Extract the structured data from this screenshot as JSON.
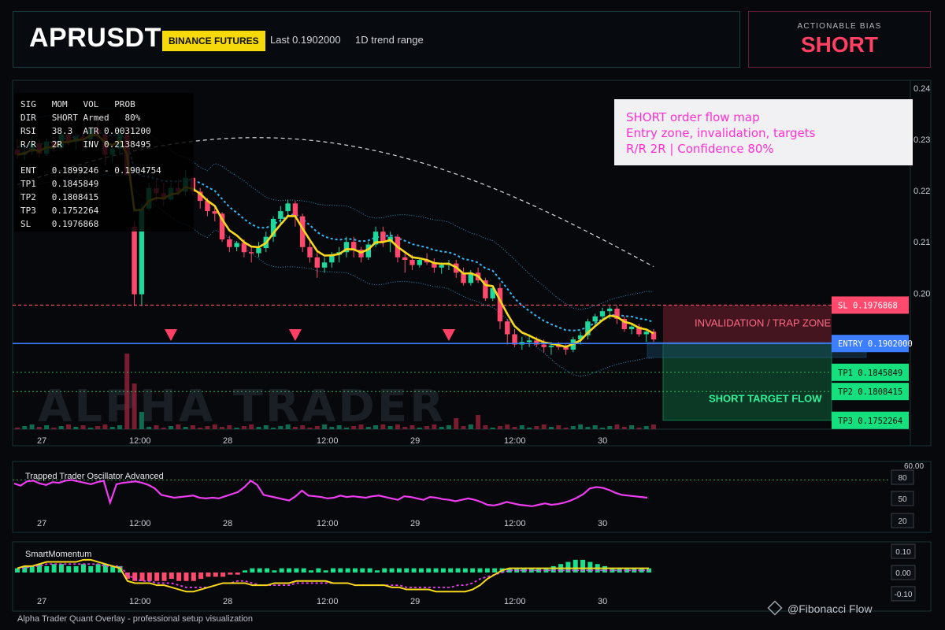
{
  "header": {
    "symbol": "APRUSDT",
    "exchange": "BINANCE FUTURES",
    "last": "Last 0.1902000",
    "range": "1D trend range",
    "bias_label": "ACTIONABLE BIAS",
    "bias_value": "SHORT"
  },
  "signal_box": {
    "rows": [
      "SIG   MOM   VOL   PROB",
      "DIR   SHORT Armed   80%",
      "RSI   38.3  ATR 0.0031200",
      "R/R   2R    INV 0.2138495",
      "",
      "ENT   0.1899246 - 0.1904754",
      "TP1   0.1845849",
      "TP2   0.1808415",
      "TP3   0.1752264",
      "SL    0.1976868"
    ]
  },
  "info_box": {
    "line1": "SHORT order flow map",
    "line2": "Entry zone, invalidation, targets",
    "line3": "R/R 2R | Confidence 80%"
  },
  "watermark": "ALPHA TRADER",
  "footer": "Alpha Trader Quant Overlay - professional setup visualization",
  "credit": "@Fibonacci Flow",
  "colors": {
    "up": "#1fd89c",
    "down": "#ff4a6e",
    "ema": "#f8d81c",
    "ema_slow": "#33b6f3",
    "entry": "#3d7dff",
    "sl": "#ff4a6e",
    "tp": "#16e07d",
    "oscillator": "#ee3cf0"
  },
  "chart_data": [
    {
      "type": "candlestick",
      "name": "APRUSDT price",
      "x_ticks": [
        "27",
        "12:00",
        "28",
        "12:00",
        "29",
        "12:00",
        "30"
      ],
      "y_ticks": [
        "0.24",
        "0.23",
        "0.22",
        "0.21",
        "0.20"
      ],
      "ylim": [
        0.1735,
        0.2415
      ],
      "ohlc": [
        [
          0.228,
          0.23,
          0.2262,
          0.227
        ],
        [
          0.227,
          0.229,
          0.226,
          0.2276
        ],
        [
          0.2276,
          0.2305,
          0.227,
          0.2292
        ],
        [
          0.2292,
          0.23,
          0.2265,
          0.2272
        ],
        [
          0.2272,
          0.2302,
          0.2268,
          0.2296
        ],
        [
          0.2296,
          0.2305,
          0.2275,
          0.2283
        ],
        [
          0.2283,
          0.232,
          0.228,
          0.231
        ],
        [
          0.231,
          0.2325,
          0.2288,
          0.2295
        ],
        [
          0.2295,
          0.2312,
          0.228,
          0.2305
        ],
        [
          0.2305,
          0.2318,
          0.2285,
          0.23
        ],
        [
          0.23,
          0.2325,
          0.229,
          0.232
        ],
        [
          0.232,
          0.2335,
          0.23,
          0.231
        ],
        [
          0.231,
          0.232,
          0.225,
          0.227
        ],
        [
          0.227,
          0.229,
          0.2255,
          0.2282
        ],
        [
          0.2282,
          0.232,
          0.227,
          0.231
        ],
        [
          0.231,
          0.232,
          0.224,
          0.223
        ],
        [
          0.213,
          0.214,
          0.1975,
          0.1998
        ],
        [
          0.1998,
          0.2175,
          0.1975,
          0.2165
        ],
        [
          0.2165,
          0.2215,
          0.216,
          0.2205
        ],
        [
          0.2205,
          0.2225,
          0.218,
          0.2195
        ],
        [
          0.2195,
          0.2215,
          0.217,
          0.2183
        ],
        [
          0.2183,
          0.2215,
          0.218,
          0.2205
        ],
        [
          0.2205,
          0.222,
          0.219,
          0.2198
        ],
        [
          0.2198,
          0.224,
          0.219,
          0.2225
        ],
        [
          0.2225,
          0.2228,
          0.219,
          0.2198
        ],
        [
          0.2198,
          0.2205,
          0.2165,
          0.218
        ],
        [
          0.218,
          0.2185,
          0.215,
          0.216
        ],
        [
          0.216,
          0.217,
          0.214,
          0.2155
        ],
        [
          0.2155,
          0.2158,
          0.21,
          0.2105
        ],
        [
          0.2105,
          0.2112,
          0.208,
          0.209
        ],
        [
          0.209,
          0.2102,
          0.2082,
          0.2098
        ],
        [
          0.2098,
          0.2105,
          0.207,
          0.208
        ],
        [
          0.208,
          0.209,
          0.206,
          0.2078
        ],
        [
          0.2078,
          0.21,
          0.207,
          0.2088
        ],
        [
          0.2088,
          0.212,
          0.208,
          0.211
        ],
        [
          0.211,
          0.215,
          0.21,
          0.2145
        ],
        [
          0.2145,
          0.217,
          0.2135,
          0.216
        ],
        [
          0.216,
          0.2182,
          0.215,
          0.2175
        ],
        [
          0.2175,
          0.218,
          0.213,
          0.215
        ],
        [
          0.215,
          0.2155,
          0.208,
          0.209
        ],
        [
          0.209,
          0.21,
          0.206,
          0.207
        ],
        [
          0.207,
          0.208,
          0.203,
          0.205
        ],
        [
          0.205,
          0.207,
          0.204,
          0.206
        ],
        [
          0.206,
          0.208,
          0.205,
          0.2075
        ],
        [
          0.2075,
          0.209,
          0.206,
          0.208
        ],
        [
          0.208,
          0.211,
          0.207,
          0.21
        ],
        [
          0.21,
          0.211,
          0.207,
          0.2085
        ],
        [
          0.2085,
          0.209,
          0.206,
          0.207
        ],
        [
          0.207,
          0.21,
          0.2065,
          0.2095
        ],
        [
          0.2095,
          0.213,
          0.209,
          0.212
        ],
        [
          0.212,
          0.213,
          0.209,
          0.21
        ],
        [
          0.21,
          0.212,
          0.208,
          0.211
        ],
        [
          0.211,
          0.2115,
          0.206,
          0.207
        ],
        [
          0.207,
          0.208,
          0.204,
          0.2065
        ],
        [
          0.2065,
          0.2075,
          0.2045,
          0.2055
        ],
        [
          0.2055,
          0.207,
          0.205,
          0.2065
        ],
        [
          0.2065,
          0.2078,
          0.2055,
          0.206
        ],
        [
          0.206,
          0.2068,
          0.204,
          0.205
        ],
        [
          0.205,
          0.206,
          0.2038,
          0.2055
        ],
        [
          0.2055,
          0.2065,
          0.2045,
          0.2058
        ],
        [
          0.2058,
          0.2065,
          0.203,
          0.204
        ],
        [
          0.204,
          0.205,
          0.2015,
          0.202
        ],
        [
          0.202,
          0.2045,
          0.2015,
          0.204
        ],
        [
          0.204,
          0.205,
          0.202,
          0.2025
        ],
        [
          0.2025,
          0.203,
          0.1985,
          0.199
        ],
        [
          0.199,
          0.2015,
          0.1985,
          0.201
        ],
        [
          0.201,
          0.202,
          0.193,
          0.1945
        ],
        [
          0.1945,
          0.195,
          0.19,
          0.192
        ],
        [
          0.192,
          0.193,
          0.1895,
          0.19
        ],
        [
          0.19,
          0.1915,
          0.189,
          0.1905
        ],
        [
          0.1905,
          0.192,
          0.1895,
          0.1908
        ],
        [
          0.1908,
          0.1915,
          0.1895,
          0.19
        ],
        [
          0.19,
          0.191,
          0.1885,
          0.1895
        ],
        [
          0.1895,
          0.1905,
          0.188,
          0.1898
        ],
        [
          0.1898,
          0.1905,
          0.189,
          0.1895
        ],
        [
          0.1895,
          0.19,
          0.188,
          0.189
        ],
        [
          0.189,
          0.1915,
          0.1885,
          0.191
        ],
        [
          0.191,
          0.1925,
          0.19,
          0.1918
        ],
        [
          0.1918,
          0.195,
          0.191,
          0.1945
        ],
        [
          0.1945,
          0.196,
          0.1935,
          0.1955
        ],
        [
          0.1955,
          0.1972,
          0.1945,
          0.1965
        ],
        [
          0.1965,
          0.1975,
          0.195,
          0.197
        ],
        [
          0.197,
          0.1975,
          0.194,
          0.195
        ],
        [
          0.195,
          0.1955,
          0.1925,
          0.193
        ],
        [
          0.193,
          0.1942,
          0.192,
          0.1935
        ],
        [
          0.1935,
          0.194,
          0.1915,
          0.192
        ],
        [
          0.192,
          0.193,
          0.1905,
          0.1925
        ],
        [
          0.1925,
          0.193,
          0.1905,
          0.191
        ]
      ],
      "levels": {
        "sl": {
          "label": "SL 0.1976868",
          "value": 0.1976868
        },
        "entry": {
          "label": "ENTRY 0.1902000",
          "value": 0.1902
        },
        "tp1": {
          "label": "TP1 0.1845849",
          "value": 0.1845849
        },
        "tp2": {
          "label": "TP2 0.1808415",
          "value": 0.1808415
        },
        "tp3": {
          "label": "TP3 0.1752264",
          "value": 0.1752264
        }
      },
      "zones": {
        "invalidation": "INVALIDATION / TRAP ZONE",
        "target": "SHORT TARGET FLOW"
      },
      "sell_signals": [
        21,
        38,
        59
      ]
    },
    {
      "type": "line",
      "name": "Trapped Trader Oscillator Advanced",
      "y_ticks": [
        "60.00",
        "80",
        "50",
        "20"
      ],
      "x_ticks": [
        "27",
        "12:00",
        "28",
        "12:00",
        "29",
        "12:00",
        "30"
      ],
      "reference": 80,
      "ylim": [
        15,
        95
      ],
      "values": [
        75,
        72,
        78,
        79,
        75,
        73,
        77,
        76,
        79,
        80,
        78,
        76,
        74,
        77,
        79,
        48,
        74,
        76,
        77,
        78,
        76,
        73,
        68,
        59,
        57,
        55,
        56,
        57,
        58,
        55,
        54,
        55,
        54,
        57,
        60,
        63,
        70,
        79,
        73,
        59,
        57,
        55,
        53,
        51,
        57,
        65,
        58,
        57,
        56,
        54,
        55,
        58,
        56,
        57,
        56,
        55,
        57,
        58,
        56,
        54,
        52,
        57,
        56,
        54,
        52,
        56,
        55,
        53,
        52,
        50,
        52,
        54,
        52,
        49,
        45,
        44,
        46,
        49,
        47,
        45,
        44,
        43,
        45,
        47,
        45,
        46,
        48,
        51,
        55,
        60,
        68,
        70,
        69,
        66,
        62,
        59,
        58,
        57,
        56,
        55
      ]
    },
    {
      "type": "bar",
      "name": "SmartMomentum",
      "y_ticks": [
        "0.10",
        "0.00",
        "-0.10"
      ],
      "x_ticks": [
        "27",
        "12:00",
        "28",
        "12:00",
        "29",
        "12:00",
        "30"
      ],
      "ylim": [
        -0.13,
        0.13
      ],
      "histogram": [
        0.02,
        0.03,
        0.03,
        0.04,
        0.03,
        0.04,
        0.04,
        0.03,
        0.03,
        0.04,
        0.03,
        0.04,
        0.04,
        0.03,
        0.03,
        -0.03,
        -0.04,
        -0.04,
        -0.04,
        -0.04,
        -0.04,
        -0.03,
        -0.04,
        -0.04,
        -0.04,
        -0.03,
        -0.02,
        -0.02,
        -0.02,
        -0.01,
        -0.01,
        0.01,
        0.02,
        0.02,
        0.02,
        0.01,
        0.02,
        0.02,
        0.02,
        0.02,
        0.01,
        0.02,
        0.01,
        0.02,
        0.02,
        0.02,
        0.02,
        0.02,
        0.02,
        0.01,
        0.02,
        0.02,
        0.02,
        0.02,
        0.02,
        0.02,
        0.02,
        0.02,
        0.02,
        0.02,
        0.02,
        0.02,
        0.02,
        0.02,
        0.02,
        0.02,
        0.02,
        0.02,
        0.02,
        0.02,
        0.02,
        0.02,
        0.02,
        0.03,
        0.04,
        0.05,
        0.06,
        0.06,
        0.05,
        0.04,
        0.03,
        0.02,
        0.02,
        0.02,
        0.02,
        0.02,
        0.02
      ],
      "signal_line": [
        0.02,
        0.02,
        0.03,
        0.03,
        0.04,
        0.04,
        0.04,
        0.04,
        0.04,
        0.04,
        0.04,
        0.04,
        0.03,
        0.03,
        0.03,
        -0.01,
        -0.03,
        -0.04,
        -0.04,
        -0.05,
        -0.05,
        -0.05,
        -0.06,
        -0.07,
        -0.07,
        -0.07,
        -0.07,
        -0.06,
        -0.05,
        -0.05,
        -0.04,
        -0.04,
        -0.05,
        -0.06,
        -0.06,
        -0.06,
        -0.06,
        -0.06,
        -0.05,
        -0.05,
        -0.05,
        -0.05,
        -0.05,
        -0.05,
        -0.05,
        -0.05,
        -0.06,
        -0.06,
        -0.06,
        -0.06,
        -0.06,
        -0.06,
        -0.06,
        -0.07,
        -0.07,
        -0.07,
        -0.07,
        -0.07,
        -0.07,
        -0.07,
        -0.06,
        -0.06,
        -0.05,
        -0.03,
        -0.02,
        -0.01,
        0.0,
        0.01,
        0.01,
        0.01,
        0.01,
        0.01,
        0.01,
        0.01,
        0.01,
        0.01,
        0.01,
        0.01,
        0.01,
        0.01,
        0.01,
        0.01,
        0.01,
        0.01,
        0.01,
        0.01,
        0.01
      ],
      "momentum_line": [
        0.02,
        0.03,
        0.03,
        0.04,
        0.05,
        0.05,
        0.05,
        0.05,
        0.05,
        0.06,
        0.06,
        0.05,
        0.04,
        0.03,
        0.02,
        -0.04,
        -0.05,
        -0.05,
        -0.05,
        -0.06,
        -0.06,
        -0.07,
        -0.08,
        -0.09,
        -0.09,
        -0.08,
        -0.07,
        -0.06,
        -0.05,
        -0.05,
        -0.05,
        -0.05,
        -0.06,
        -0.06,
        -0.06,
        -0.05,
        -0.05,
        -0.05,
        -0.04,
        -0.04,
        -0.04,
        -0.04,
        -0.04,
        -0.05,
        -0.05,
        -0.05,
        -0.06,
        -0.06,
        -0.06,
        -0.06,
        -0.06,
        -0.07,
        -0.07,
        -0.08,
        -0.08,
        -0.08,
        -0.08,
        -0.09,
        -0.09,
        -0.09,
        -0.09,
        -0.09,
        -0.08,
        -0.06,
        -0.03,
        -0.01,
        0.01,
        0.02,
        0.02,
        0.02,
        0.02,
        0.02,
        0.02,
        0.02,
        0.02,
        0.02,
        0.02,
        0.02,
        0.02,
        0.02,
        0.02,
        0.02,
        0.02,
        0.02,
        0.02,
        0.02,
        0.02
      ]
    }
  ]
}
